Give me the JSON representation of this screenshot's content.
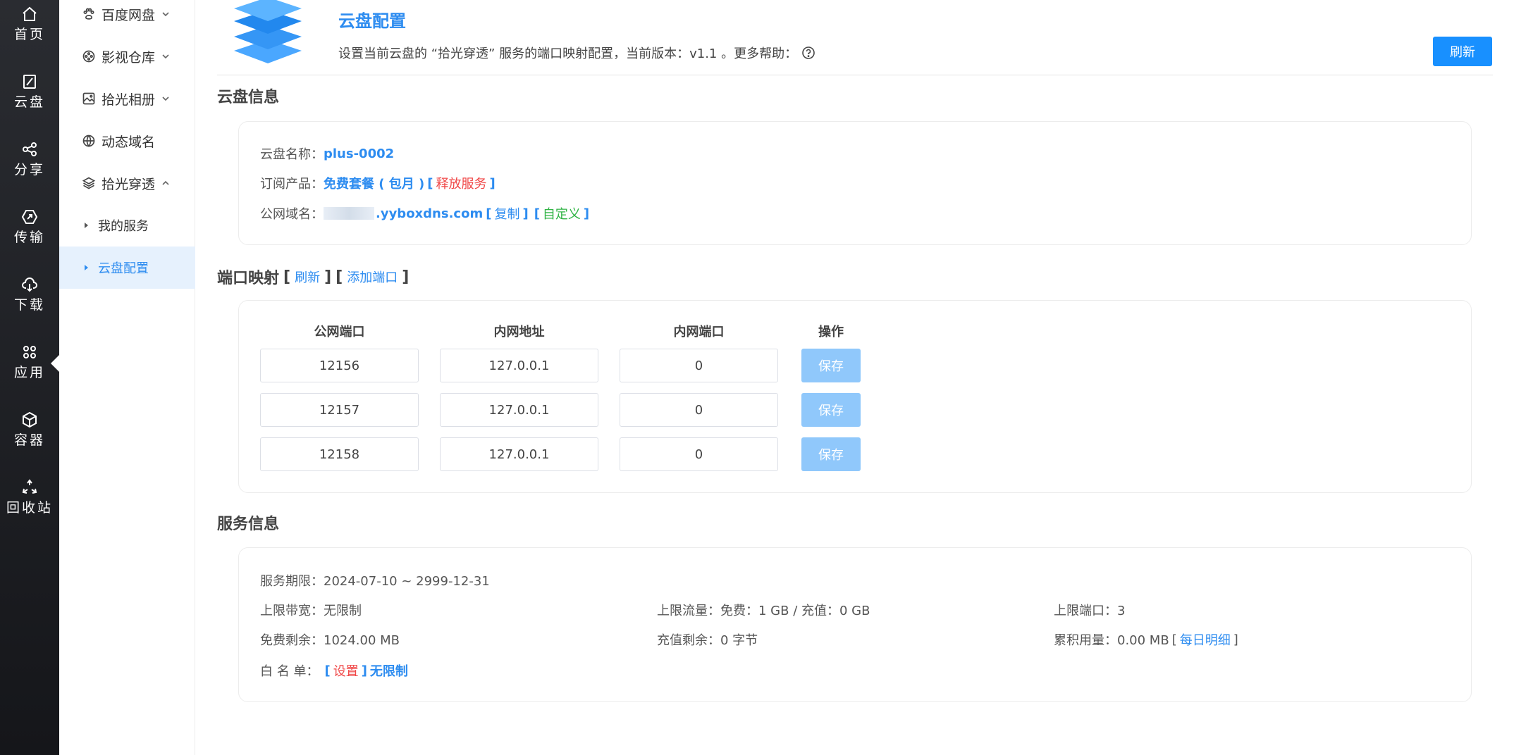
{
  "rail": {
    "items": [
      {
        "label": "首页",
        "icon": "home-icon"
      },
      {
        "label": "云盘",
        "icon": "cloud-disk-icon"
      },
      {
        "label": "分享",
        "icon": "share-icon"
      },
      {
        "label": "传输",
        "icon": "transfer-icon"
      },
      {
        "label": "下载",
        "icon": "download-icon"
      },
      {
        "label": "应用",
        "icon": "apps-icon"
      },
      {
        "label": "容器",
        "icon": "container-icon"
      },
      {
        "label": "回收站",
        "icon": "recycle-icon"
      }
    ]
  },
  "menu": {
    "items": [
      {
        "label": "百度网盘",
        "icon": "paw-icon"
      },
      {
        "label": "影视仓库",
        "icon": "film-reel-icon"
      },
      {
        "label": "拾光相册",
        "icon": "image-icon"
      },
      {
        "label": "动态域名",
        "icon": "globe-icon"
      },
      {
        "label": "拾光穿透",
        "icon": "layers-icon"
      }
    ],
    "sub_items": [
      {
        "label": "我的服务"
      },
      {
        "label": "云盘配置"
      }
    ]
  },
  "header": {
    "title": "云盘配置",
    "desc": "设置当前云盘的 “拾光穿透” 服务的端口映射配置，当前版本：v1.1 。更多帮助：",
    "refresh_label": "刷新"
  },
  "cloud_info": {
    "section_title": "云盘信息",
    "name_label": "云盘名称：",
    "name_value": "plus-0002",
    "product_label": "订阅产品：",
    "product_value": "免费套餐 ( 包月 )",
    "release_label": "释放服务",
    "domain_label": "公网域名：",
    "domain_value": ".yyboxdns.com",
    "copy_label": "复制",
    "custom_label": "自定义"
  },
  "port_mapping": {
    "section_title": "端口映射",
    "refresh_label": "刷新",
    "add_label": "添加端口",
    "headers": [
      "公网端口",
      "内网地址",
      "内网端口",
      "操作"
    ],
    "rows": [
      {
        "public_port": "12156",
        "internal_addr": "127.0.0.1",
        "internal_port": "0",
        "save": "保存"
      },
      {
        "public_port": "12157",
        "internal_addr": "127.0.0.1",
        "internal_port": "0",
        "save": "保存"
      },
      {
        "public_port": "12158",
        "internal_addr": "127.0.0.1",
        "internal_port": "0",
        "save": "保存"
      }
    ]
  },
  "service_info": {
    "section_title": "服务信息",
    "period": "服务期限：2024-07-10 ~ 2999-12-31",
    "bandwidth": "上限带宽：无限制",
    "traffic": "上限流量：免费：1 GB / 充值：0 GB",
    "ports": "上限端口：3",
    "free_remaining": "免费剩余：1024.00 MB",
    "paid_remaining": "充值剩余：0 字节",
    "cumulative": "累积用量：0.00 MB",
    "daily_detail": "每日明细",
    "whitelist_label": "白 名 单：",
    "whitelist_set": "设置",
    "whitelist_value": "无限制"
  },
  "colors": {
    "accent": "#2d8cf0",
    "primary_button": "#1890ff",
    "disabled_button": "#90c8fb",
    "danger": "#f04646",
    "success": "#2fb344",
    "rail_bg": "#1c1d21",
    "active_menu_bg": "#e6f1fd"
  }
}
